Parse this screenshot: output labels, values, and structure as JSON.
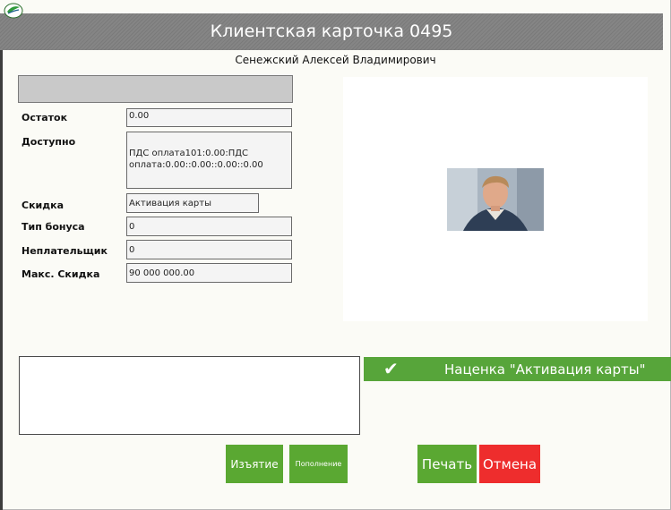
{
  "window": {
    "title": "Клиентская карточка 0495",
    "client_name": "Сенежский Алексей Владимирович"
  },
  "fields": {
    "balance": {
      "label": "Остаток",
      "value": "0.00"
    },
    "available": {
      "label": "Доступно",
      "value": "ПДС оплата101:0.00:ПДС оплата:0.00::0.00::0.00::0.00"
    },
    "discount": {
      "label": "Скидка",
      "value": "Активация карты"
    },
    "bonus_type": {
      "label": "Тип бонуса",
      "value": "0"
    },
    "non_payer": {
      "label": "Неплательщик",
      "value": "0"
    },
    "max_discount": {
      "label": "Макс. Скидка",
      "value": "90 000 000.00"
    }
  },
  "markup": {
    "check_icon": "check-icon",
    "label": "Наценка \"Активация карты\""
  },
  "buttons": {
    "withdraw": "Изъятие",
    "topup": "Пополнение",
    "print": "Печать",
    "cancel": "Отмена"
  },
  "colors": {
    "green": "#5aa832",
    "red": "#ee2d2d",
    "title_gray": "#808080"
  }
}
